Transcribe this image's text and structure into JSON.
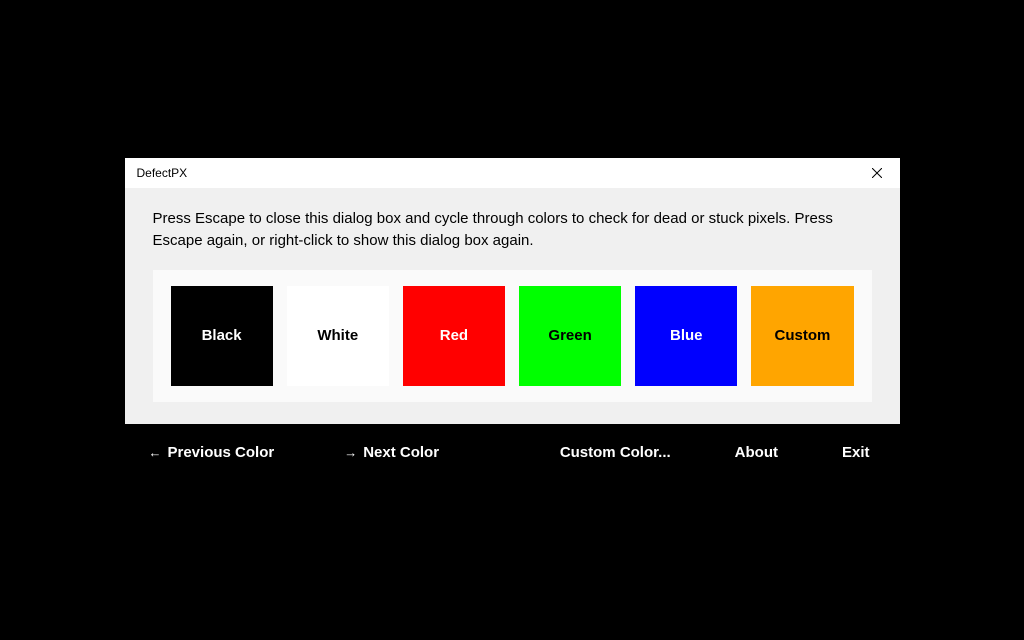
{
  "titlebar": {
    "title": "DefectPX"
  },
  "instruction": "Press Escape to close this dialog box and cycle through colors to check for dead or stuck pixels. Press Escape again, or right-click to show this dialog box again.",
  "swatches": {
    "black": "Black",
    "white": "White",
    "red": "Red",
    "green": "Green",
    "blue": "Blue",
    "custom": "Custom"
  },
  "bottombar": {
    "previous": "Previous Color",
    "next": "Next Color",
    "custom": "Custom Color...",
    "about": "About",
    "exit": "Exit"
  }
}
